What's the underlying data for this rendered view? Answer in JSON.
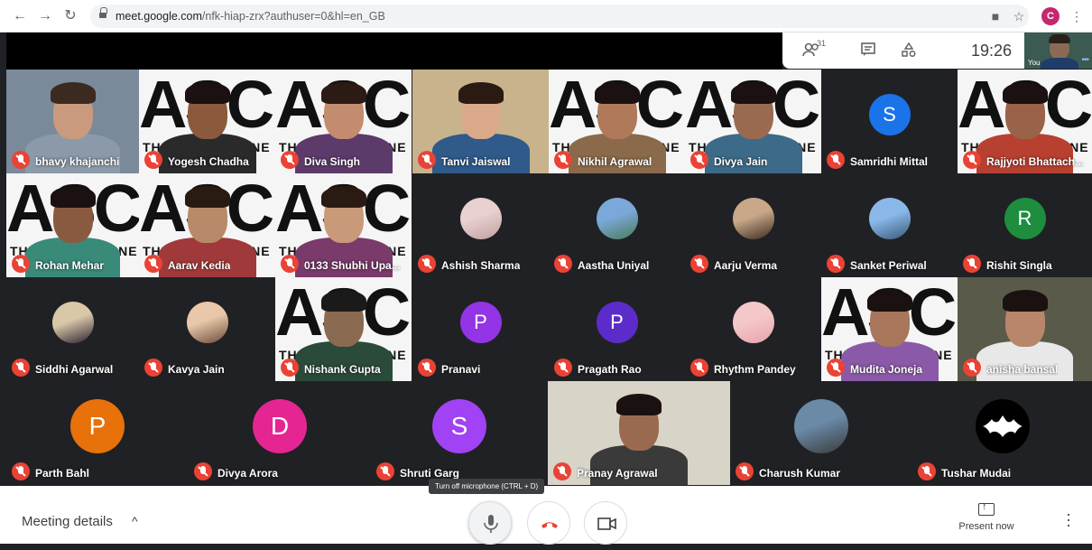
{
  "browser": {
    "url_host": "meet.google.com",
    "url_path": "/nfk-hiap-zrx?authuser=0&hl=en_GB",
    "profile_letter": "C"
  },
  "topbar": {
    "people_count": "31",
    "clock": "19:26",
    "self_label": "You"
  },
  "tiles": [
    {
      "name": "bhavy khajanchi"
    },
    {
      "name": "Yogesh Chadha"
    },
    {
      "name": "Diva Singh"
    },
    {
      "name": "Tanvi Jaiswal"
    },
    {
      "name": "Nikhil Agrawal"
    },
    {
      "name": "Divya Jain"
    },
    {
      "name": "Samridhi Mittal",
      "letter": "S",
      "color": "#1a73e8"
    },
    {
      "name": "Rajjyoti Bhattach..."
    },
    {
      "name": "Rohan Mehar"
    },
    {
      "name": "Aarav Kedia"
    },
    {
      "name": "0133 Shubhi Upa..."
    },
    {
      "name": "Ashish Sharma"
    },
    {
      "name": "Aastha Uniyal"
    },
    {
      "name": "Aarju Verma"
    },
    {
      "name": "Sanket Periwal"
    },
    {
      "name": "Rishit Singla",
      "letter": "R",
      "color": "#1e8e3e"
    },
    {
      "name": "Siddhi Agarwal"
    },
    {
      "name": "Kavya Jain"
    },
    {
      "name": "Nishank Gupta"
    },
    {
      "name": "Pranavi",
      "letter": "P",
      "color": "#9334e6"
    },
    {
      "name": "Pragath Rao",
      "letter": "P",
      "color": "#5b2cc9"
    },
    {
      "name": "Rhythm Pandey"
    },
    {
      "name": "Mudita Joneja"
    },
    {
      "name": "anisha bansal"
    },
    {
      "name": "Parth Bahl",
      "letter": "P",
      "color": "#e8710a"
    },
    {
      "name": "Divya Arora",
      "letter": "D",
      "color": "#e52592"
    },
    {
      "name": "Shruti Garg",
      "letter": "S",
      "color": "#a142f4"
    },
    {
      "name": "Pranay Agrawal"
    },
    {
      "name": "Charush Kumar"
    },
    {
      "name": "Tushar Mudai"
    }
  ],
  "asce": {
    "word": "ASCE",
    "tagline": "THE ENTREPRENE"
  },
  "controls": {
    "meeting_details": "Meeting details",
    "tooltip": "Turn off microphone (CTRL + D)",
    "present_now": "Present now"
  }
}
